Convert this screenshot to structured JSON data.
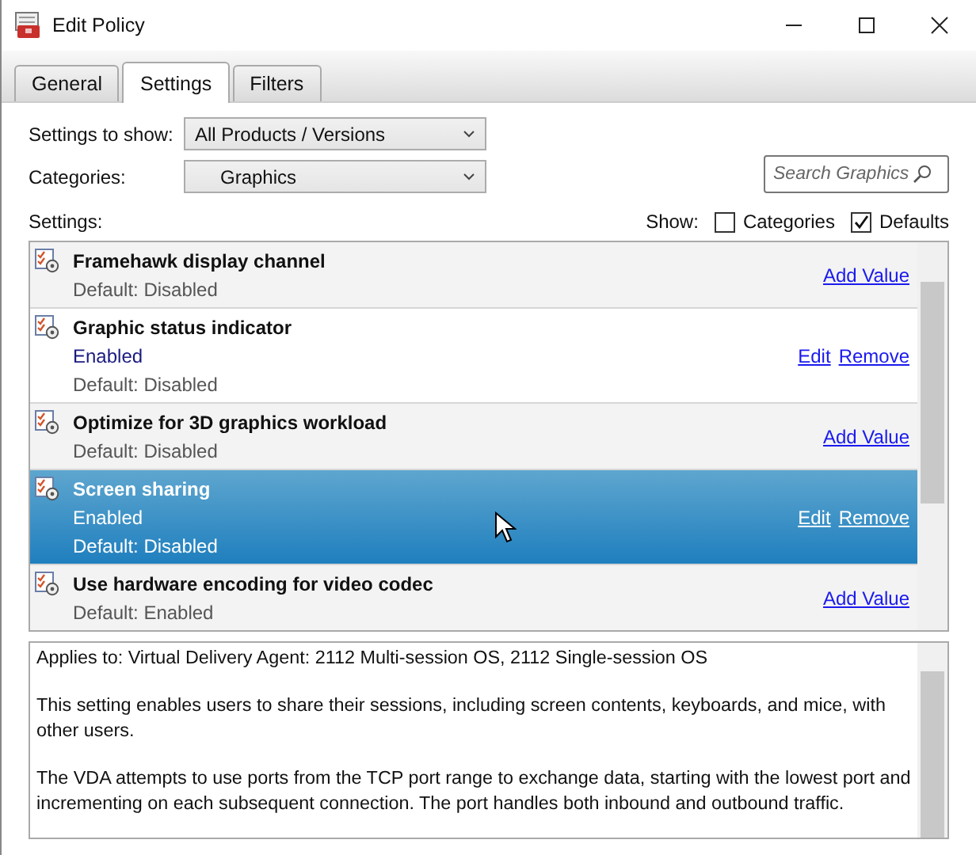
{
  "window": {
    "title": "Edit Policy"
  },
  "tabs": [
    {
      "label": "General",
      "selected": false
    },
    {
      "label": "Settings",
      "selected": true
    },
    {
      "label": "Filters",
      "selected": false
    }
  ],
  "filters": [
    {
      "label": "Settings to show:",
      "value": "All Products / Versions"
    },
    {
      "label": "Categories:",
      "value": "Graphics"
    }
  ],
  "search": {
    "placeholder": "Search Graphics"
  },
  "settings_label": "Settings:",
  "show": {
    "label": "Show:",
    "options": [
      {
        "label": "Categories",
        "checked": false
      },
      {
        "label": "Defaults",
        "checked": true
      }
    ]
  },
  "settings": [
    {
      "name": "Framehawk display channel",
      "default": "Default: Disabled",
      "actions": [
        "Add Value"
      ],
      "selected": false
    },
    {
      "name": "Graphic status indicator",
      "value": "Enabled",
      "default": "Default: Disabled",
      "actions": [
        "Edit",
        "Remove"
      ],
      "selected": false
    },
    {
      "name": "Optimize for 3D graphics workload",
      "default": "Default: Disabled",
      "actions": [
        "Add Value"
      ],
      "selected": false
    },
    {
      "name": "Screen sharing",
      "value": "Enabled",
      "default": "Default: Disabled",
      "actions": [
        "Edit",
        "Remove"
      ],
      "selected": true
    },
    {
      "name": "Use hardware encoding for video codec",
      "default": "Default: Enabled",
      "actions": [
        "Add Value"
      ],
      "selected": false
    }
  ],
  "description": [
    "Applies to: Virtual Delivery Agent: 2112 Multi-session OS, 2112 Single-session OS",
    "This setting enables users to share their sessions, including screen contents, keyboards, and mice, with other users.",
    "The VDA attempts to use ports from the TCP port range to exchange data, starting with the lowest port and incrementing on each subsequent connection. The port handles both inbound and outbound traffic."
  ]
}
